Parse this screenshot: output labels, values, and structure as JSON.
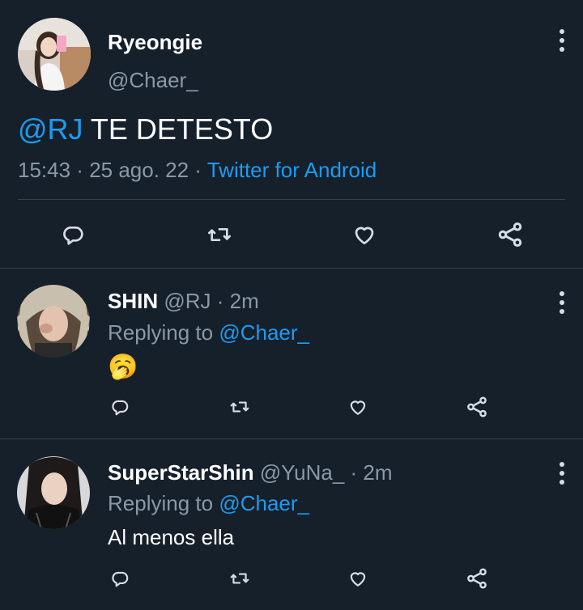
{
  "main_tweet": {
    "display_name": "Ryeongie",
    "handle": "@Chaer_",
    "mention": "@RJ",
    "text": " TE DETESTO",
    "time": "15:43",
    "sep1": " · ",
    "date": "25 ago. 22",
    "sep2": " · ",
    "source": "Twitter for Android"
  },
  "replies": [
    {
      "display_name": "SHIN",
      "handle": "@RJ",
      "time_sep": " · ",
      "time": "2m",
      "replying_prefix": "Replying to ",
      "replying_to": "@Chaer_",
      "text": "🥱"
    },
    {
      "display_name": "SuperStarShin",
      "handle": "@YuNa_",
      "time_sep": " · ",
      "time": "2m",
      "replying_prefix": "Replying to ",
      "replying_to": "@Chaer_",
      "text": "Al menos ella"
    }
  ],
  "icons": {
    "reply": "reply-icon",
    "retweet": "retweet-icon",
    "like": "heart-icon",
    "share": "share-icon",
    "more": "more-vertical-icon"
  },
  "colors": {
    "background": "#15202b",
    "text": "#ffffff",
    "muted": "#8b98a5",
    "link": "#1d9bf0",
    "divider": "#38444d"
  }
}
